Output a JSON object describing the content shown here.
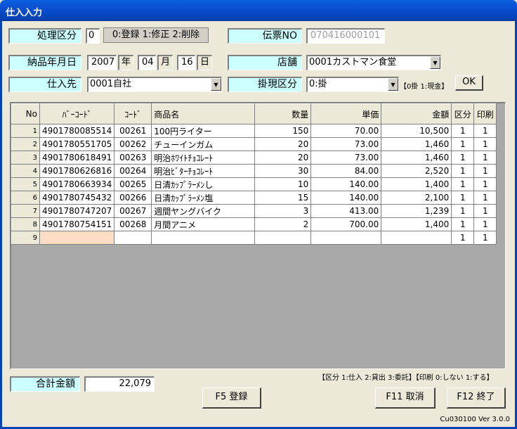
{
  "window": {
    "title": "仕入入力"
  },
  "form": {
    "processing": {
      "label": "処理区分",
      "value": "0",
      "options_text": "0:登録 1:修正 2:削除"
    },
    "voucher": {
      "label": "伝票NO",
      "value": "070416000101"
    },
    "delivery_date": {
      "label": "納品年月日",
      "year": "2007",
      "year_unit": "年",
      "month": "04",
      "month_unit": "月",
      "day": "16",
      "day_unit": "日"
    },
    "store": {
      "label": "店舗",
      "value": "0001カストマン食堂"
    },
    "supplier": {
      "label": "仕入先",
      "value": "0001自社"
    },
    "payment": {
      "label": "掛現区分",
      "value": "0:掛",
      "hint": "【0掛 1:現金】",
      "ok_label": "OK"
    }
  },
  "grid": {
    "columns": [
      "No",
      "ﾊﾞｰｺｰﾄﾞ",
      "ｺｰﾄﾞ",
      "商品名",
      "数量",
      "単価",
      "金額",
      "区分",
      "印刷"
    ],
    "rows": [
      [
        "1",
        "4901780085514",
        "00261",
        "100円ライター",
        "150",
        "70.00",
        "10,500",
        "1",
        "1"
      ],
      [
        "2",
        "4901780551705",
        "00262",
        "チューインガム",
        "20",
        "73.00",
        "1,460",
        "1",
        "1"
      ],
      [
        "3",
        "4901780618491",
        "00263",
        "明治ﾎﾜｲﾄﾁｮｺﾚｰﾄ",
        "20",
        "73.00",
        "1,460",
        "1",
        "1"
      ],
      [
        "4",
        "4901780626816",
        "00264",
        "明治ﾋﾞﾀｰﾁｮｺﾚｰﾄ",
        "30",
        "84.00",
        "2,520",
        "1",
        "1"
      ],
      [
        "5",
        "4901780663934",
        "00265",
        "日清ｶｯﾌﾟﾗｰﾒﾝし",
        "10",
        "140.00",
        "1,400",
        "1",
        "1"
      ],
      [
        "6",
        "4901780745432",
        "00266",
        "日清ｶｯﾌﾟﾗｰﾒﾝ塩",
        "15",
        "140.00",
        "2,100",
        "1",
        "1"
      ],
      [
        "7",
        "4901780747207",
        "00267",
        "週間ヤングバイク",
        "3",
        "413.00",
        "1,239",
        "1",
        "1"
      ],
      [
        "8",
        "4901780754151",
        "00268",
        "月間アニメ",
        "2",
        "700.00",
        "1,400",
        "1",
        "1"
      ],
      [
        "9",
        "",
        "",
        "",
        "",
        "",
        "",
        "1",
        "1"
      ]
    ]
  },
  "footer": {
    "total_label": "合計金額",
    "total_value": "22,079",
    "legend": "【区分 1:仕入 2:貸出 3:委託】【印刷 0:しない 1:する】",
    "register_label": "F5 登録",
    "cancel_label": "F11 取消",
    "exit_label": "F12 終了",
    "version": "Cu030100 Ver 3.0.0"
  },
  "colors": {
    "label_bg": "#ccffff",
    "active_cell": "#ffdcc4",
    "titlebar": "#0a4fd0"
  }
}
